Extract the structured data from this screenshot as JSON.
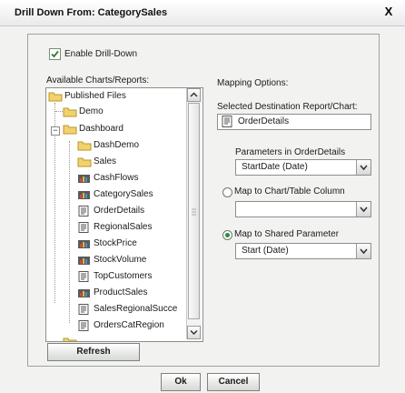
{
  "dialog": {
    "title": "Drill Down From: CategorySales",
    "close_glyph": "X"
  },
  "enable_drilldown": {
    "label": "Enable Drill-Down",
    "checked": true
  },
  "charts_panel": {
    "label": "Available Charts/Reports:",
    "items": [
      {
        "label": "Published Files",
        "icon": "folder-icon"
      },
      {
        "label": "Demo",
        "icon": "folder-icon"
      },
      {
        "label": "Dashboard",
        "icon": "folder-icon"
      },
      {
        "label": "DashDemo",
        "icon": "folder-icon"
      },
      {
        "label": "Sales",
        "icon": "folder-icon"
      },
      {
        "label": "CashFlows",
        "icon": "chart-icon"
      },
      {
        "label": "CategorySales",
        "icon": "chart-icon"
      },
      {
        "label": "OrderDetails",
        "icon": "report-icon"
      },
      {
        "label": "RegionalSales",
        "icon": "report-icon"
      },
      {
        "label": "StockPrice",
        "icon": "chart-icon"
      },
      {
        "label": "StockVolume",
        "icon": "chart-icon"
      },
      {
        "label": "TopCustomers",
        "icon": "report-icon"
      },
      {
        "label": "ProductSales",
        "icon": "chart-icon"
      },
      {
        "label": "SalesRegionalSucce",
        "icon": "report-icon"
      },
      {
        "label": "OrdersCatRegion",
        "icon": "report-icon"
      }
    ],
    "refresh_label": "Refresh"
  },
  "mapping": {
    "label": "Mapping Options:",
    "dest_label": "Selected Destination Report/Chart:",
    "dest_value": "OrderDetails",
    "params_label": "Parameters in OrderDetails",
    "params_value": "StartDate (Date)",
    "map_column_label": "Map to Chart/Table Column",
    "map_column_value": "",
    "map_shared_label": "Map to Shared Parameter",
    "map_shared_value": "Start (Date)",
    "selected_option": "shared"
  },
  "footer": {
    "ok_label": "Ok",
    "cancel_label": "Cancel"
  }
}
